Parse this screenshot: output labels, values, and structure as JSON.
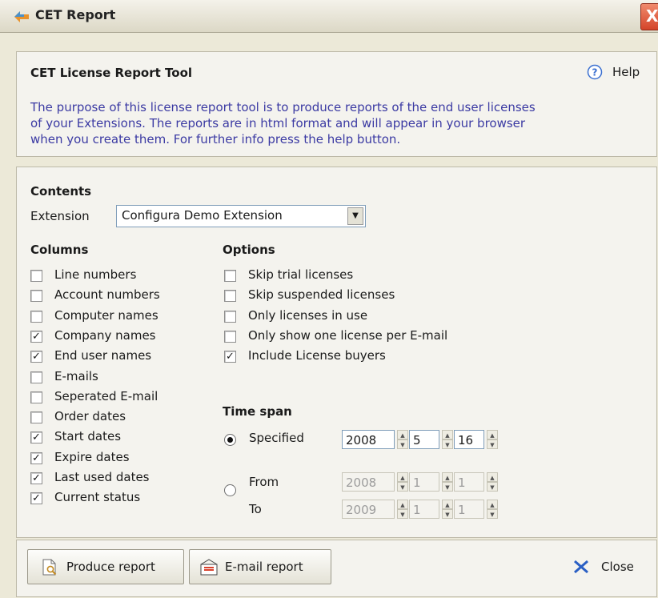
{
  "window": {
    "title": "CET Report",
    "close_glyph": "X"
  },
  "header": {
    "title": "CET License Report Tool",
    "help_label": "Help",
    "description_lines": [
      "The purpose of this license report tool is to produce reports of the end user licenses",
      "of your Extensions. The reports are in html format and will appear in your browser",
      "when you create them. For further info press the help button."
    ]
  },
  "contents": {
    "title": "Contents",
    "extension_label": "Extension",
    "extension_value": "Configura Demo Extension"
  },
  "columns": {
    "title": "Columns",
    "items": [
      {
        "label": "Line numbers",
        "checked": false
      },
      {
        "label": "Account numbers",
        "checked": false
      },
      {
        "label": "Computer names",
        "checked": false
      },
      {
        "label": "Company names",
        "checked": true
      },
      {
        "label": "End user names",
        "checked": true
      },
      {
        "label": "E-mails",
        "checked": false
      },
      {
        "label": "Seperated E-mail",
        "checked": false
      },
      {
        "label": "Order dates",
        "checked": false
      },
      {
        "label": "Start dates",
        "checked": true
      },
      {
        "label": "Expire dates",
        "checked": true
      },
      {
        "label": "Last used dates",
        "checked": true
      },
      {
        "label": "Current status",
        "checked": true
      }
    ]
  },
  "options": {
    "title": "Options",
    "items": [
      {
        "label": "Skip trial licenses",
        "checked": false
      },
      {
        "label": "Skip suspended licenses",
        "checked": false
      },
      {
        "label": "Only licenses in use",
        "checked": false
      },
      {
        "label": "Only show one license per E-mail",
        "checked": false
      },
      {
        "label": "Include License buyers",
        "checked": true
      }
    ]
  },
  "timespan": {
    "title": "Time span",
    "specified_label": "Specified",
    "specified_selected": true,
    "specified": {
      "year": "2008",
      "month": "5",
      "day": "16"
    },
    "from_label": "From",
    "to_label": "To",
    "from": {
      "year": "2008",
      "month": "1",
      "day": "1"
    },
    "to": {
      "year": "2009",
      "month": "1",
      "day": "1"
    }
  },
  "footer": {
    "produce_label": "Produce report",
    "email_label": "E-mail report",
    "close_label": "Close"
  },
  "colors": {
    "description_text": "#3b3aa3",
    "close_x": "#2a5fc4"
  }
}
